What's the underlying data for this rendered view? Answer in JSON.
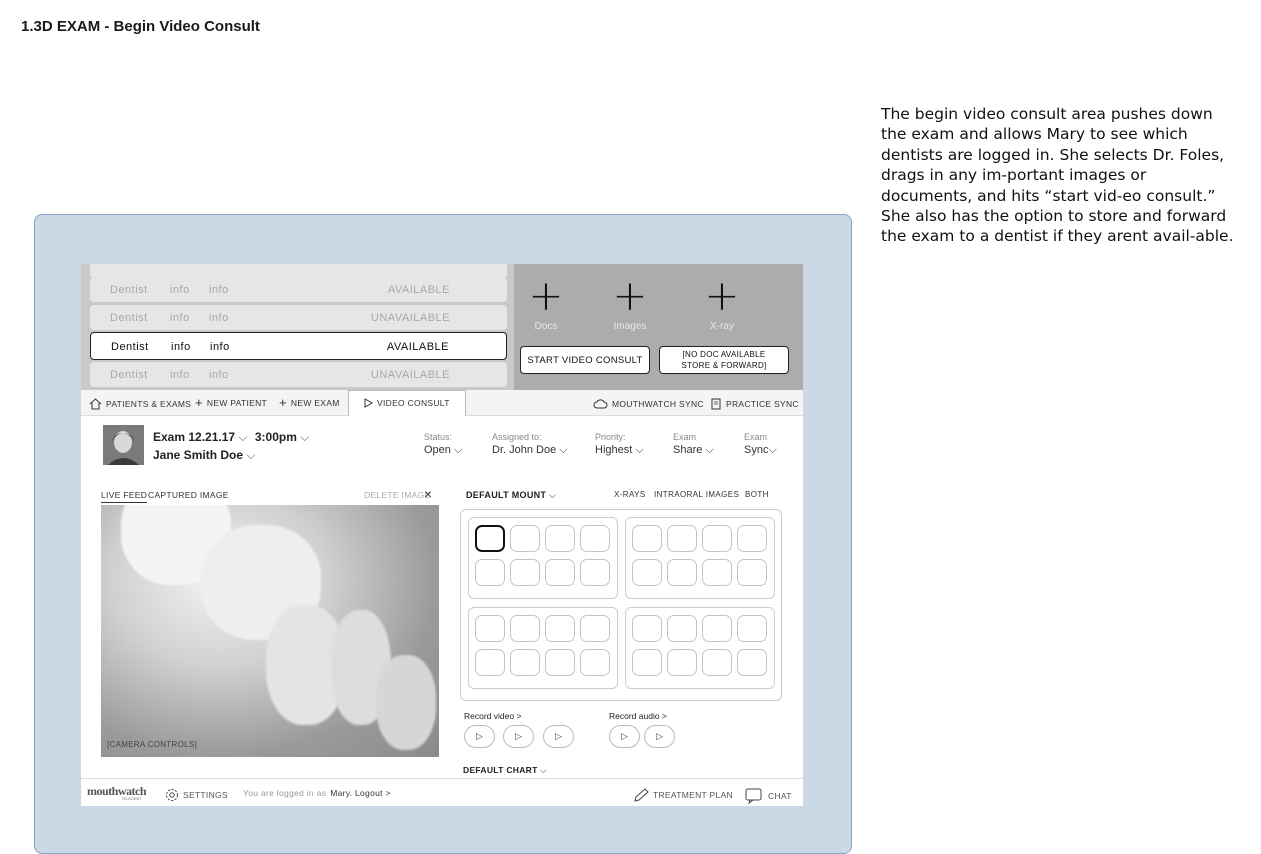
{
  "page": {
    "title": "1.3D EXAM - Begin Video Consult",
    "description": "The begin video consult area pushes down the exam and allows Mary to see which dentists are logged in. She selects Dr. Foles, drags in any im-portant images or documents, and hits “start vid-eo consult.” She also has the option to store and forward the exam to a dentist if they arent avail-able."
  },
  "dentists": [
    {
      "name": "Dentist",
      "info1": "info",
      "info2": "info",
      "status": "AVAILABLE"
    },
    {
      "name": "Dentist",
      "info1": "info",
      "info2": "info",
      "status": "UNAVAILABLE"
    },
    {
      "name": "Dentist",
      "info1": "info",
      "info2": "info",
      "status": "AVAILABLE"
    },
    {
      "name": "Dentist",
      "info1": "info",
      "info2": "info",
      "status": "UNAVAILABLE"
    }
  ],
  "drop": {
    "docs": "Docs",
    "images": "Images",
    "xray": "X-ray",
    "start": "START VIDEO CONSULT",
    "store_line1": "[NO DOC AVAILABLE",
    "store_line2": "STORE & FORWARD]"
  },
  "nav": {
    "patients": "PATIENTS & EXAMS",
    "new_patient": "NEW PATIENT",
    "new_exam": "NEW EXAM",
    "video": "VIDEO CONSULT",
    "mw_sync": "MOUTHWATCH SYNC",
    "practice_sync": "PRACTICE SYNC"
  },
  "exam": {
    "date": "Exam 12.21.17",
    "time": "3:00pm",
    "patient": "Jane Smith Doe",
    "status_label": "Status:",
    "status": "Open",
    "assigned_label": "Assigned to:",
    "assigned": "Dr. John Doe",
    "priority_label": "Priority:",
    "priority": "Highest",
    "share_label": "Exam",
    "share": "Share",
    "sync_label": "Exam",
    "sync": "Sync"
  },
  "camera": {
    "live": "LIVE FEED",
    "captured": "CAPTURED IMAGE",
    "delete": "DELETE IMAGE",
    "controls": "[CAMERA CONTROLS]"
  },
  "mount": {
    "title": "DEFAULT MOUNT",
    "xrays": "X-RAYS",
    "intraoral": "INTRAORAL IMAGES",
    "both": "BOTH",
    "record_video": "Record video >",
    "record_audio": "Record audio >",
    "chart": "DEFAULT CHART"
  },
  "footer": {
    "logo": "mouthwatch",
    "logo_sub": "TELEDENT",
    "settings": "SETTINGS",
    "logged_prefix": "You are logged in as",
    "logged_user": "Mary. Logout >",
    "treatment": "TREATMENT PLAN",
    "chat": "CHAT"
  }
}
